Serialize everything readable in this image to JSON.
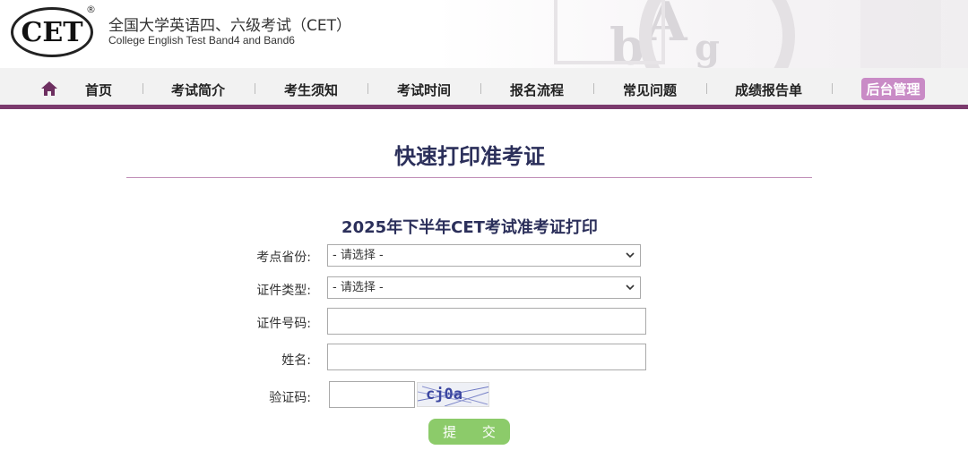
{
  "header": {
    "logo_text": "CET",
    "logo_registered": "®",
    "title_cn": "全国大学英语四、六级考试（CET）",
    "title_en": "College English Test Band4 and Band6"
  },
  "nav": {
    "items": [
      "首页",
      "考试简介",
      "考生须知",
      "考试时间",
      "报名流程",
      "常见问题",
      "成绩报告单"
    ],
    "admin": "后台管理"
  },
  "main": {
    "page_title": "快速打印准考证",
    "form_title": "2025年下半年CET考试准考证打印"
  },
  "form": {
    "province_label": "考点省份:",
    "province_value": "- 请选择 -",
    "id_type_label": "证件类型:",
    "id_type_value": "- 请选择 -",
    "id_number_label": "证件号码:",
    "name_label": "姓名:",
    "captcha_label": "验证码:",
    "captcha_text": "cj0a",
    "submit_label": "提 交"
  },
  "colors": {
    "accent": "#7b3a6d",
    "admin": "#c98bc6",
    "title": "#2b2f5a",
    "submit": "#8ccb6a"
  }
}
